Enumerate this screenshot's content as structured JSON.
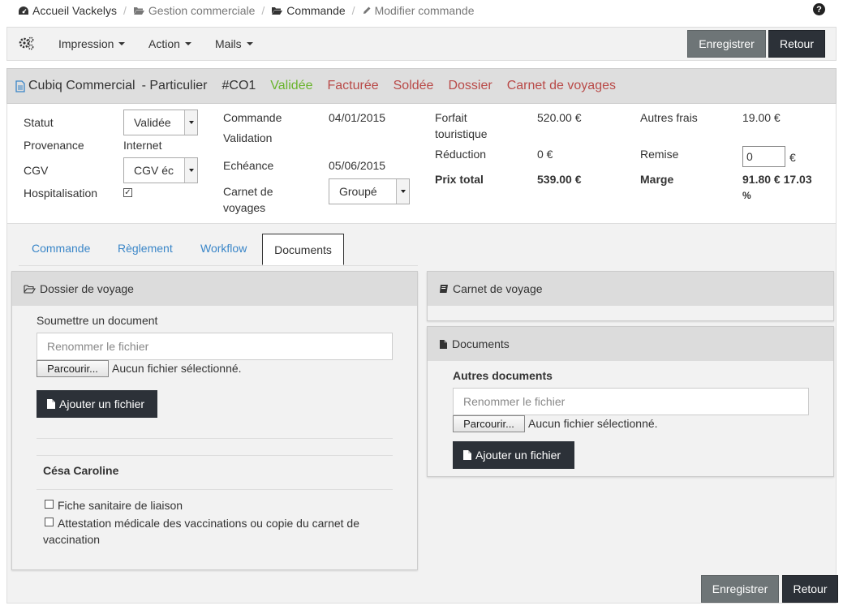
{
  "breadcrumb": {
    "home": "Accueil Vackelys",
    "gestion": "Gestion commerciale",
    "commande": "Commande",
    "modifier": "Modifier commande"
  },
  "toolbar": {
    "menus": {
      "impression": "Impression",
      "action": "Action",
      "mails": "Mails"
    },
    "save": "Enregistrer",
    "back": "Retour"
  },
  "order": {
    "title": "Cubiq Commercial",
    "client_type": "- Particulier",
    "number": "#CO1",
    "status_validee": "Validée",
    "status_facturee": "Facturée",
    "status_soldee": "Soldée",
    "status_dossier": "Dossier",
    "status_carnet": "Carnet de voyages",
    "colors": {
      "validee": "#6ab42d",
      "red": "#b94a48",
      "link": "#3a86c8"
    }
  },
  "details": {
    "statut_label": "Statut",
    "statut_value": "Validée",
    "provenance_label": "Provenance",
    "provenance_value": "Internet",
    "cgv_label": "CGV",
    "cgv_value": "CGV éc",
    "hospitalisation_label": "Hospitalisation",
    "hospitalisation_checked": "✓",
    "commande_label": "Commande",
    "commande_date": "04/01/2015",
    "validation_label": "Validation",
    "echeance_label": "Echéance",
    "echeance_date": "05/06/2015",
    "carnet_label_1": "Carnet de",
    "carnet_label_2": "voyages",
    "carnet_value": "Groupé",
    "forfait_label_1": "Forfait",
    "forfait_label_2": "touristique",
    "forfait_value": "520.00 €",
    "reduction_label": "Réduction",
    "reduction_value": "0 €",
    "prix_total_label": "Prix total",
    "prix_total_value": "539.00 €",
    "autres_frais_label": "Autres frais",
    "autres_frais_value": "19.00 €",
    "remise_label": "Remise",
    "remise_value": "0",
    "remise_unit": "€",
    "marge_label": "Marge",
    "marge_value_1": "91.80 € 17.03",
    "marge_value_2": "%"
  },
  "tabs": {
    "commande": "Commande",
    "reglement": "Règlement",
    "workflow": "Workflow",
    "documents": "Documents"
  },
  "dossier": {
    "title": "Dossier de voyage",
    "submit_label": "Soumettre un document",
    "rename_placeholder": "Renommer le fichier",
    "browse": "Parcourir...",
    "no_file": "Aucun fichier sélectionné.",
    "add_file": "Ajouter un fichier",
    "person": "Césa Caroline",
    "doc1": "Fiche sanitaire de liaison",
    "doc2_line1": "Attestation médicale des vaccinations ou copie du carnet de",
    "doc2_line2": "vaccination"
  },
  "carnet": {
    "title": "Carnet de voyage"
  },
  "documents": {
    "title": "Documents",
    "other_label": "Autres documents",
    "rename_placeholder": "Renommer le fichier",
    "browse": "Parcourir...",
    "no_file": "Aucun fichier sélectionné.",
    "add_file": "Ajouter un fichier"
  }
}
